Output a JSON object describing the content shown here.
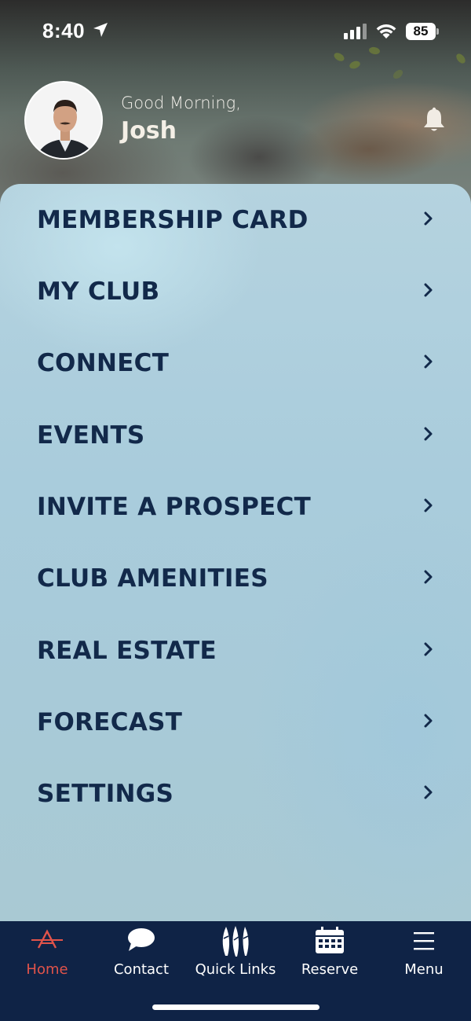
{
  "status_bar": {
    "time": "8:40",
    "battery": "85",
    "icons": [
      "location-arrow-icon",
      "signal-icon",
      "wifi-icon",
      "battery-icon"
    ]
  },
  "header": {
    "greeting": "Good Morning,",
    "user_name": "Josh",
    "icons": [
      "avatar",
      "bell-icon"
    ]
  },
  "menu": {
    "items": [
      {
        "label": "MEMBERSHIP CARD"
      },
      {
        "label": "MY CLUB"
      },
      {
        "label": "CONNECT"
      },
      {
        "label": "EVENTS"
      },
      {
        "label": "INVITE A PROSPECT"
      },
      {
        "label": "CLUB AMENITIES"
      },
      {
        "label": "REAL ESTATE"
      },
      {
        "label": "FORECAST"
      },
      {
        "label": "SETTINGS"
      }
    ],
    "chevron_icon": "chevron-right-icon"
  },
  "bottom_nav": {
    "items": [
      {
        "label": "Home",
        "icon": "home-logo-icon",
        "active": true
      },
      {
        "label": "Contact",
        "icon": "chat-bubble-icon",
        "active": false
      },
      {
        "label": "Quick Links",
        "icon": "surfboards-icon",
        "active": false
      },
      {
        "label": "Reserve",
        "icon": "calendar-icon",
        "active": false
      },
      {
        "label": "Menu",
        "icon": "hamburger-menu-icon",
        "active": false
      }
    ]
  },
  "colors": {
    "navy": "#12294a",
    "nav_background": "#0f2346",
    "active_accent": "#e1534a"
  }
}
